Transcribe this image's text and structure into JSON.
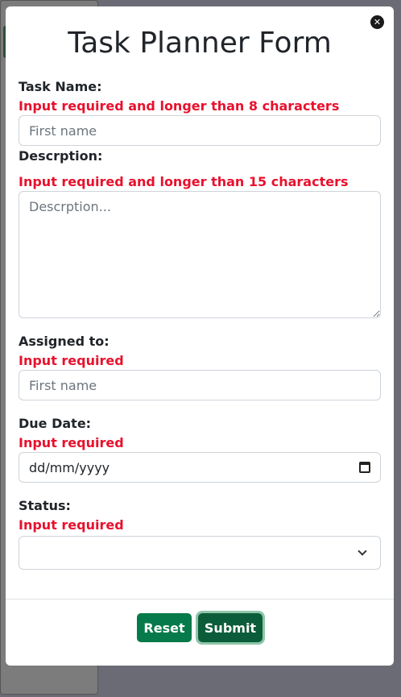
{
  "modal": {
    "title": "Task Planner Form",
    "close_icon": "close-icon"
  },
  "fields": {
    "task_name": {
      "label": "Task Name:",
      "error": "Input required and longer than 8 characters",
      "placeholder": "First name",
      "value": ""
    },
    "description": {
      "label": "Descrption:",
      "error": "Input required and longer than 15 characters",
      "placeholder": "Descrption...",
      "value": ""
    },
    "assigned_to": {
      "label": "Assigned to:",
      "error": "Input required",
      "placeholder": "First name",
      "value": ""
    },
    "due_date": {
      "label": "Due Date:",
      "error": "Input required",
      "value": "dd/mm/yyyy"
    },
    "status": {
      "label": "Status:",
      "error": "Input required",
      "selected": ""
    }
  },
  "footer": {
    "reset_label": "Reset",
    "submit_label": "Submit"
  },
  "colors": {
    "error": "#e8112d",
    "button": "#067a4a",
    "submit_focus_ring": "#8fc5a9"
  }
}
